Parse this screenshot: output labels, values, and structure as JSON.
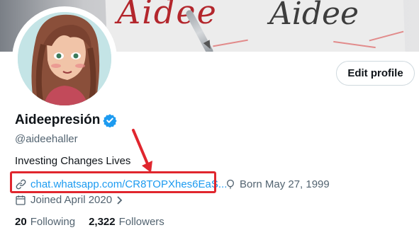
{
  "profile": {
    "display_name": "Aideepresión",
    "handle": "@aideehaller",
    "bio": "Investing Changes Lives",
    "link": "chat.whatsapp.com/CR8TOPXhes6EaS...",
    "birthday": "Born May 27, 1999",
    "joined": "Joined April 2020",
    "following_count": "20",
    "following_label": "Following",
    "followers_count": "2,322",
    "followers_label": "Followers"
  },
  "actions": {
    "edit_profile": "Edit profile"
  },
  "icons": {
    "verified": "verified-badge-icon",
    "link": "link-icon",
    "birthday": "balloon-icon",
    "joined": "calendar-icon",
    "chevron": "chevron-right-icon"
  },
  "colors": {
    "accent": "#1d9bf0",
    "annotation": "#e0262e",
    "secondary_text": "#536471"
  }
}
